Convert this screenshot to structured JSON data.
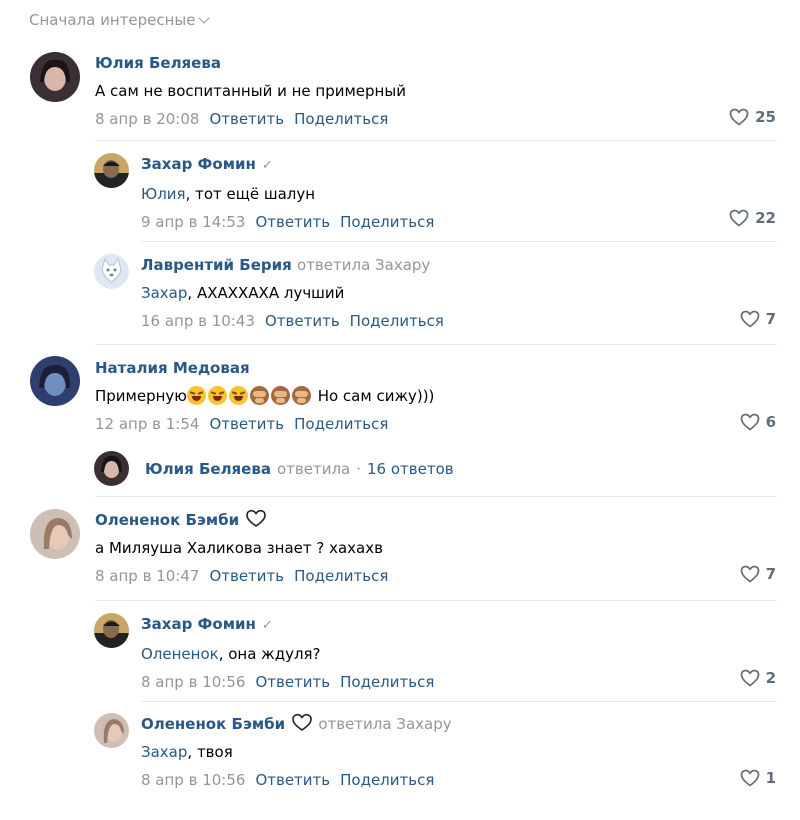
{
  "sort_label": "Сначала интересные",
  "actions": {
    "reply": "Ответить",
    "share": "Поделиться"
  },
  "comments": [
    {
      "author": "Юлия Беляева",
      "text": "А сам не воспитанный и не примерный",
      "date": "8 апр в 20:08",
      "likes": "25",
      "avatar": "woman-dark-hair"
    },
    {
      "author": "Захар Фомин",
      "verified": "✓",
      "mention": "Юлия",
      "text": ", тот ещё шалун",
      "date": "9 апр в 14:53",
      "likes": "22",
      "avatar": "man-dark"
    },
    {
      "author": "Лаврентий Берия",
      "reply_meta": "ответила Захару",
      "mention": "Захар",
      "text": ", АХАХХАХА лучший",
      "date": "16 апр в 10:43",
      "likes": "7",
      "avatar": "dog-icon"
    },
    {
      "author": "Наталия Медовая",
      "text_before": "Примерную",
      "text_after": " Но сам сижу)))",
      "emoji": [
        "rolling-on-floor-laughing",
        "rolling-on-floor-laughing",
        "rolling-on-floor-laughing",
        "see-no-evil-monkey",
        "see-no-evil-monkey",
        "see-no-evil-monkey"
      ],
      "date": "12 апр в 1:54",
      "likes": "6",
      "avatar": "woman-blue"
    },
    {
      "author": "Олененок Бэмби",
      "text": "а Миляуша Халикова знает ? хахахв",
      "date": "8 апр в 10:47",
      "likes": "7",
      "avatar": "woman-light"
    },
    {
      "author": "Захар Фомин",
      "verified": "✓",
      "mention": "Олененок",
      "text": ", она ждуля?",
      "date": "8 апр в 10:56",
      "likes": "2",
      "avatar": "man-dark"
    },
    {
      "author": "Олененок Бэмби",
      "reply_meta": "ответила Захару",
      "mention": "Захар",
      "text": ", твоя",
      "date": "8 апр в 10:56",
      "likes": "1",
      "avatar": "woman-light"
    }
  ],
  "thread": {
    "author": "Юлия Беляева",
    "verb": "ответила",
    "dot": "·",
    "count": "16 ответов"
  },
  "colors": {
    "link": "#2a5885",
    "meta": "#939699",
    "separator": "#e7e8ec"
  }
}
